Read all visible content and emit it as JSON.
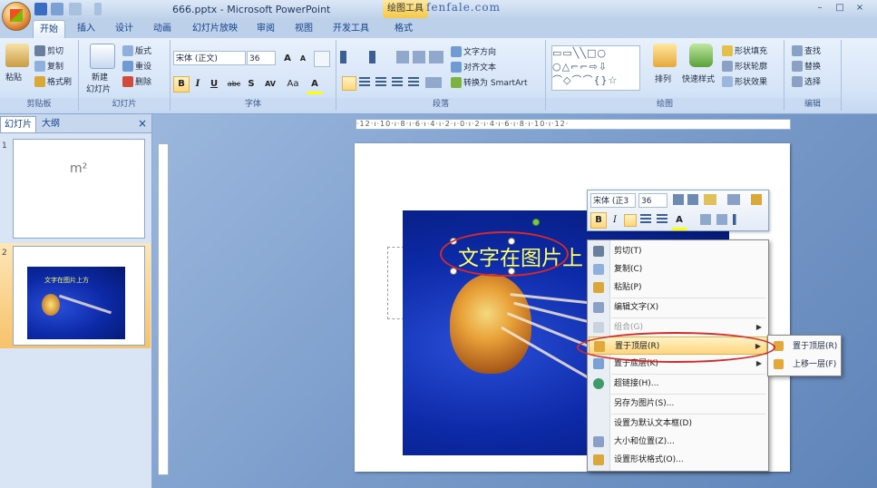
{
  "titlebar": {
    "title": "666.pptx - Microsoft PowerPoint",
    "context_tab": "绘图工具",
    "watermark": "fenfale.com"
  },
  "window_controls": [
    "–",
    "□",
    "×"
  ],
  "tabs": [
    "开始",
    "插入",
    "设计",
    "动画",
    "幻灯片放映",
    "审阅",
    "视图",
    "开发工具",
    "格式"
  ],
  "ribbon": {
    "clipboard": {
      "label": "剪贴板",
      "paste": "粘贴",
      "cut": "剪切",
      "copy": "复制",
      "format_painter": "格式刷"
    },
    "slides": {
      "label": "幻灯片",
      "new_slide": "新建",
      "new_slide2": "幻灯片",
      "layout": "版式",
      "reset": "重设",
      "delete": "删除"
    },
    "font": {
      "label": "字体",
      "font_name": "宋体 (正文)",
      "font_size": "36",
      "bold": "B",
      "italic": "I",
      "underline": "U",
      "strike": "abc",
      "shadow": "S",
      "spacing": "AV",
      "case": "Aa",
      "color": "A",
      "grow": "A",
      "shrink": "A"
    },
    "paragraph": {
      "label": "段落",
      "text_direction": "文字方向",
      "align_text": "对齐文本",
      "smartart": "转换为 SmartArt"
    },
    "drawing": {
      "label": "绘图",
      "arrange": "排列",
      "quick_styles": "快速样式",
      "shape_fill": "形状填充",
      "shape_outline": "形状轮廓",
      "shape_effects": "形状效果"
    },
    "editing": {
      "label": "编辑",
      "find": "查找",
      "replace": "替换",
      "select": "选择"
    }
  },
  "pane_tabs": {
    "slides": "幻灯片",
    "outline": "大纲",
    "close": "×"
  },
  "thumbnails": [
    {
      "num": "1",
      "text": "m²"
    },
    {
      "num": "2",
      "text": "文字在图片上方"
    }
  ],
  "ruler": {
    "h": "·12·ı·10·ı·8·ı·6·ı·4·ı·2·ı·0·ı·2·ı·4·ı·6·ı·8·ı·10·ı·12·"
  },
  "slide": {
    "text": "文字在图片上"
  },
  "minitoolbar": {
    "font_name": "宋体 (正3",
    "font_size": "36",
    "bold": "B",
    "italic": "I",
    "color": "A"
  },
  "context_menu": {
    "items": [
      {
        "label": "剪切(T)",
        "disabled": false
      },
      {
        "label": "复制(C)",
        "disabled": false
      },
      {
        "label": "粘贴(P)",
        "disabled": false
      },
      {
        "label": "编辑文字(X)",
        "disabled": false
      },
      {
        "label": "组合(G)",
        "disabled": true,
        "submenu": true
      },
      {
        "label": "置于顶层(R)",
        "disabled": false,
        "submenu": true,
        "highlight": true
      },
      {
        "label": "置于底层(K)",
        "disabled": false,
        "submenu": true
      },
      {
        "label": "超链接(H)...",
        "disabled": false
      },
      {
        "label": "另存为图片(S)...",
        "disabled": false
      },
      {
        "label": "设置为默认文本框(D)",
        "disabled": false
      },
      {
        "label": "大小和位置(Z)...",
        "disabled": false
      },
      {
        "label": "设置形状格式(O)...",
        "disabled": false
      }
    ]
  },
  "submenu": {
    "items": [
      "置于顶层(R)",
      "上移一层(F)"
    ]
  },
  "colors": {
    "accent": "#f4c94a",
    "highlight_ring": "#d42a2a",
    "slide_text": "#ffff66",
    "ribbon_text": "#15428b"
  }
}
